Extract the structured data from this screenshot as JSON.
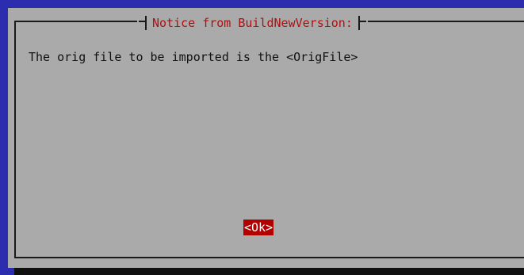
{
  "dialog": {
    "title": "Notice from BuildNewVersion:",
    "message": "The orig file to be imported is the <OrigFile>",
    "ok_label": "<Ok>"
  },
  "colors": {
    "background": "#2c2cae",
    "dialog": "#aaaaaa",
    "title_text": "#b01010",
    "button_bg": "#b00000",
    "button_text": "#ffffff"
  }
}
